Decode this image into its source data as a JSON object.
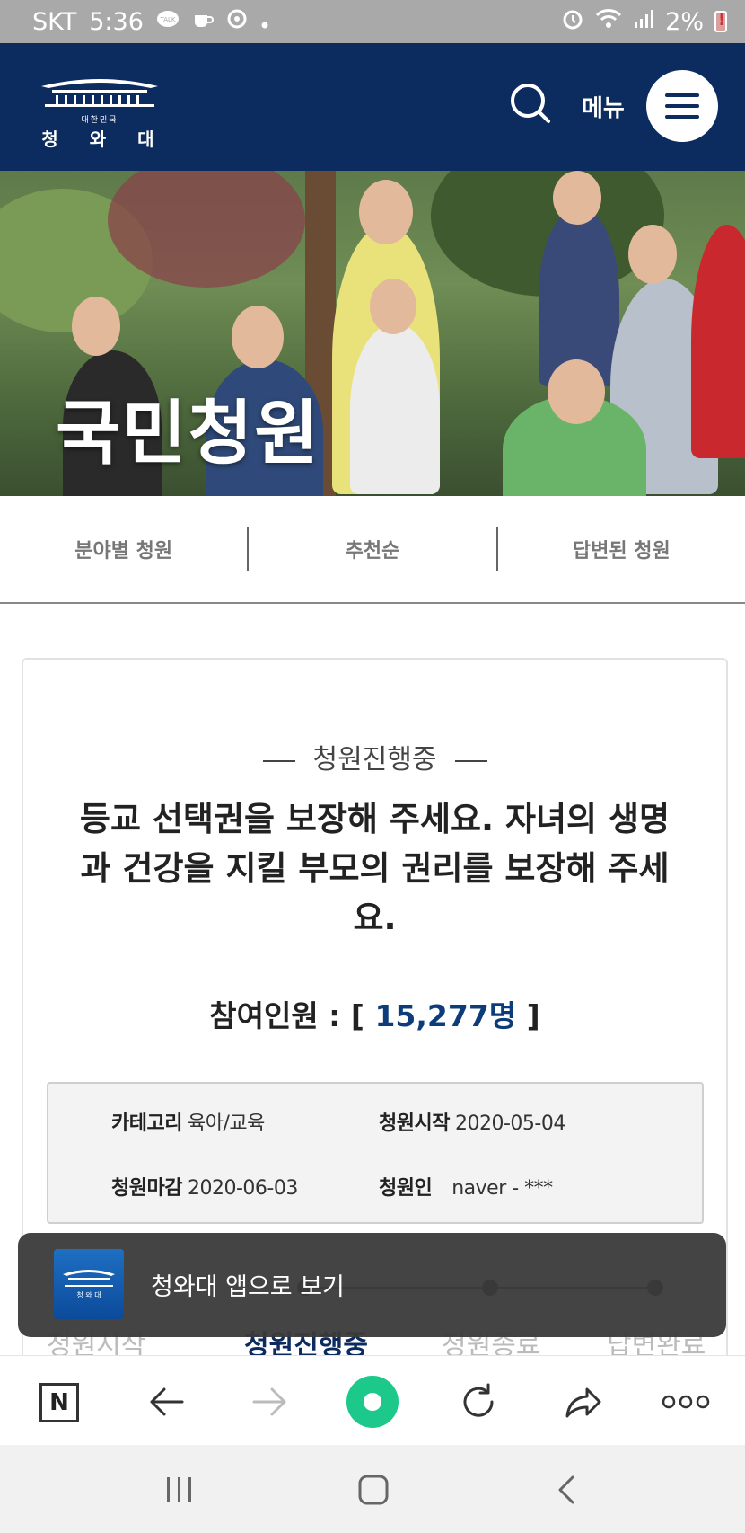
{
  "status_bar": {
    "carrier": "SKT",
    "time": "5:36",
    "battery": "2%"
  },
  "header": {
    "logo_sub": "대한민국",
    "logo_main": "청 와 대",
    "menu_label": "메뉴"
  },
  "hero": {
    "title": "국민청원"
  },
  "tabs": [
    {
      "label": "분야별 청원"
    },
    {
      "label": "추천순"
    },
    {
      "label": "답변된 청원"
    }
  ],
  "petition": {
    "status": "청원진행중",
    "title": "등교 선택권을 보장해 주세요. 자녀의 생명과 건강을 지킬 부모의 권리를 보장해 주세요.",
    "participants_label": "참여인원 : [",
    "participants_count": "15,277명",
    "participants_close": "]",
    "info": {
      "category_label": "카테고리",
      "category_value": "육아/교육",
      "start_label": "청원시작",
      "start_value": "2020-05-04",
      "end_label": "청원마감",
      "end_value": "2020-06-03",
      "author_label": "청원인",
      "author_value": "naver - ***"
    }
  },
  "progress_steps": [
    "청원시작",
    "청원진행중",
    "청원종료",
    "답변완료"
  ],
  "toast": {
    "text": "청와대 앱으로 보기"
  },
  "toolbar": {
    "n_label": "N"
  },
  "colors": {
    "header_bg": "#0c2b5e",
    "count_color": "#0c3d7a",
    "toolbar_green": "#1cc88a"
  }
}
